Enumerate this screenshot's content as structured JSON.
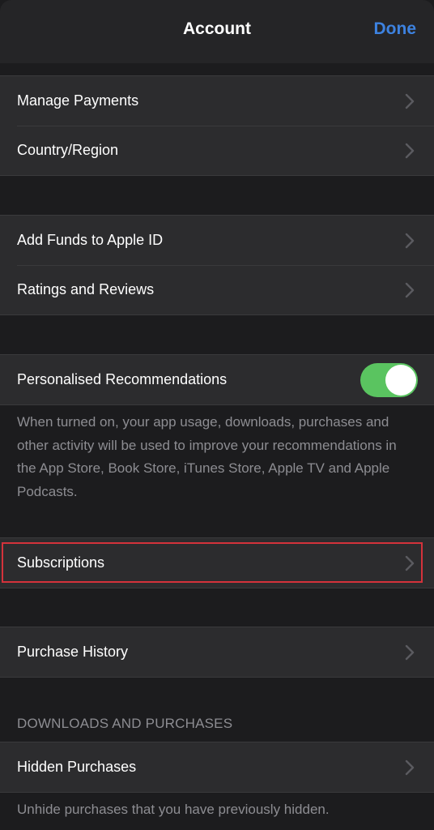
{
  "header": {
    "title": "Account",
    "done_label": "Done",
    "done_color": "#3d82e0"
  },
  "groups": [
    {
      "items": [
        {
          "label": "Manage Payments",
          "icon": "chevron-right-icon"
        },
        {
          "label": "Country/Region",
          "icon": "chevron-right-icon"
        }
      ]
    },
    {
      "items": [
        {
          "label": "Add Funds to Apple ID",
          "icon": "chevron-right-icon"
        },
        {
          "label": "Ratings and Reviews",
          "icon": "chevron-right-icon"
        }
      ]
    },
    {
      "items": [
        {
          "label": "Personalised Recommendations",
          "toggle": true,
          "toggle_state": "on"
        }
      ],
      "footer": "When turned on, your app usage, downloads, purchases and other activity will be used to improve your recommendations in the App Store, Book Store, iTunes Store, Apple TV and Apple Podcasts."
    },
    {
      "items": [
        {
          "label": "Subscriptions",
          "icon": "chevron-right-icon",
          "highlighted": true
        }
      ]
    },
    {
      "items": [
        {
          "label": "Purchase History",
          "icon": "chevron-right-icon"
        }
      ]
    },
    {
      "header": "DOWNLOADS AND PURCHASES",
      "items": [
        {
          "label": "Hidden Purchases",
          "icon": "chevron-right-icon"
        }
      ],
      "footer": "Unhide purchases that you have previously hidden."
    }
  ],
  "colors": {
    "toggle_on": "#5ac460",
    "highlight_border": "#d4323b"
  }
}
